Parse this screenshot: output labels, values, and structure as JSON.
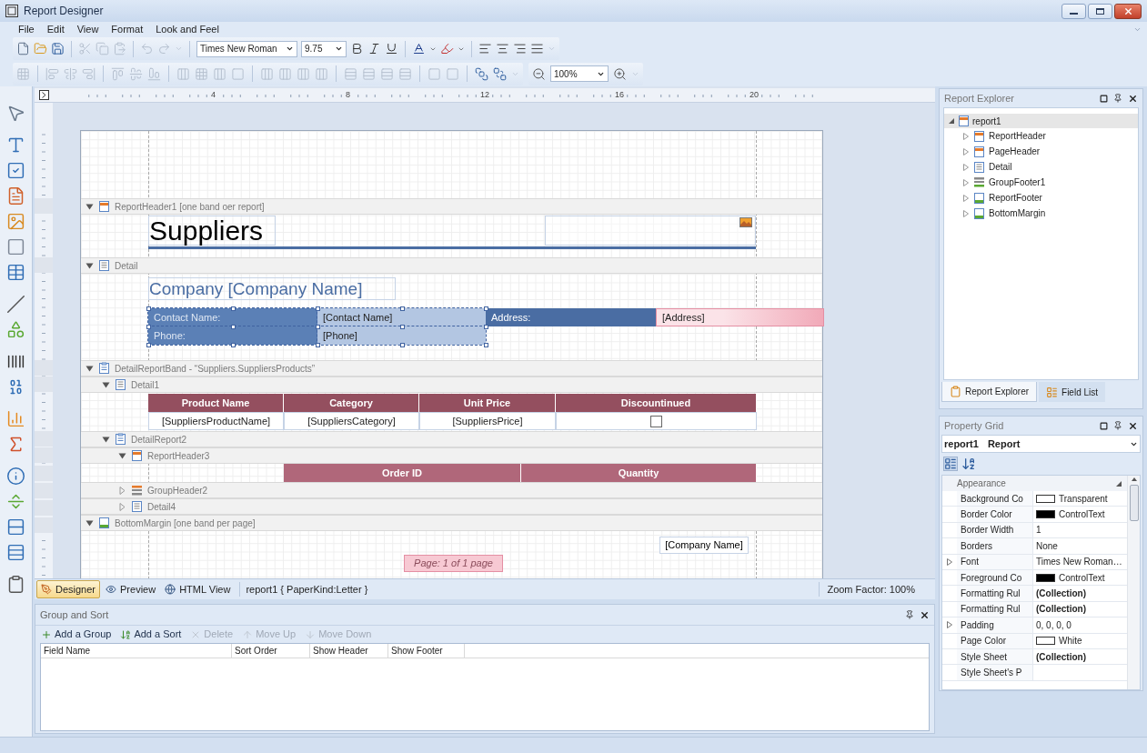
{
  "window": {
    "title": "Report Designer"
  },
  "menu": [
    "File",
    "Edit",
    "View",
    "Format",
    "Look and Feel"
  ],
  "toolbar": {
    "font": "Times New Roman",
    "size": "9.75",
    "zoom": "100%"
  },
  "ruler": [
    "4",
    "8",
    "12",
    "16",
    "20"
  ],
  "bands": [
    {
      "label": "ReportHeader1 [one band oer report]",
      "kind": "report_header",
      "expanded": true,
      "content": {
        "kind": "title",
        "title": "Suppliers"
      }
    },
    {
      "label": "Detail",
      "kind": "detail",
      "expanded": true,
      "content": {
        "kind": "company",
        "heading": "Company [Company Name]",
        "rows": [
          [
            {
              "text": "Contact Name:",
              "selected": true
            },
            {
              "text": "[Contact Name]",
              "selected": true
            },
            {
              "text": "Address:",
              "selected": false
            },
            {
              "text": "[Address]",
              "selected": false
            }
          ],
          [
            {
              "text": "Phone:",
              "selected": true
            },
            {
              "text": "[Phone]",
              "selected": true
            }
          ]
        ]
      }
    },
    {
      "label": "DetailReportBand - “Suppliers.SuppliersProducts”",
      "kind": "detail_report",
      "expanded": true,
      "children": [
        {
          "label": "Detail1",
          "kind": "detail",
          "expanded": true,
          "content": {
            "kind": "table",
            "headers": [
              "Product Name",
              "Category",
              "Unit Price",
              "Discountinued"
            ],
            "cells": [
              {
                "kind": "text",
                "text": "[SuppliersProductName]"
              },
              {
                "kind": "text",
                "text": "[SuppliersCategory]"
              },
              {
                "kind": "text",
                "text": "[SuppliersPrice]"
              },
              {
                "kind": "checkbox",
                "checked": false
              }
            ]
          }
        },
        {
          "label": "DetailReport2",
          "kind": "detail_report",
          "expanded": true,
          "children": [
            {
              "label": "ReportHeader3",
              "kind": "report_header",
              "expanded": true,
              "content": {
                "kind": "header_row",
                "headers": [
                  "Order ID",
                  "Quantity"
                ]
              }
            },
            {
              "label": "GroupHeader2",
              "kind": "group_header",
              "expanded": false
            },
            {
              "label": "Detail4",
              "kind": "detail",
              "expanded": false
            }
          ]
        }
      ]
    },
    {
      "label": "BottomMargin [one band per page]",
      "kind": "bottom_margin",
      "expanded": true,
      "content": {
        "kind": "margin",
        "field": "[Company Name]",
        "page_info": "Page: 1 of 1 page"
      }
    }
  ],
  "designer_tabs": [
    {
      "label": "Designer",
      "selected": true
    },
    {
      "label": "Preview",
      "selected": false
    },
    {
      "label": "HTML View",
      "selected": false
    }
  ],
  "designer_status": {
    "report": "report1 { PaperKind:Letter }",
    "zoom": "Zoom Factor: 100%"
  },
  "group_and_sort": {
    "title": "Group and Sort",
    "actions": [
      {
        "label": "Add a Group",
        "disabled": false
      },
      {
        "label": "Add a Sort",
        "disabled": false
      },
      {
        "label": "Delete",
        "disabled": true
      },
      {
        "label": "Move Up",
        "disabled": true
      },
      {
        "label": "Move Down",
        "disabled": true
      }
    ],
    "columns": [
      "Field Name",
      "Sort Order",
      "Show Header",
      "Show Footer"
    ]
  },
  "report_explorer": {
    "title": "Report Explorer",
    "tree": {
      "label": "report1",
      "selected": true,
      "expanded": true,
      "children": [
        {
          "label": "ReportHeader",
          "kind": "report_header",
          "selected": false,
          "expanded": false
        },
        {
          "label": "PageHeader",
          "kind": "page_header",
          "selected": false,
          "expanded": false
        },
        {
          "label": "Detail",
          "kind": "detail",
          "selected": false,
          "expanded": false
        },
        {
          "label": "GroupFooter1",
          "kind": "group_footer",
          "selected": false,
          "expanded": false
        },
        {
          "label": "ReportFooter",
          "kind": "report_footer",
          "selected": false,
          "expanded": false
        },
        {
          "label": "BottomMargin",
          "kind": "bottom_margin",
          "selected": false,
          "expanded": false
        }
      ]
    }
  },
  "explorer_tabs": [
    {
      "label": "Report Explorer",
      "selected": true
    },
    {
      "label": "Field List",
      "selected": false
    }
  ],
  "property_grid": {
    "title": "Property Grid",
    "object": "report1",
    "type": "Report",
    "category": "Appearance",
    "rows": [
      {
        "label": "Background Co",
        "value": "Transparent",
        "kind": "color",
        "color": "#ffffff",
        "expandable": false
      },
      {
        "label": "Border Color",
        "value": "ControlText",
        "kind": "color",
        "color": "#000000",
        "expandable": false
      },
      {
        "label": "Border Width",
        "value": "1",
        "kind": "text",
        "expandable": false
      },
      {
        "label": "Borders",
        "value": "None",
        "kind": "text",
        "expandable": false
      },
      {
        "label": "Font",
        "value": "Times New Roman…",
        "kind": "text",
        "expandable": true
      },
      {
        "label": "Foreground Co",
        "value": "ControlText",
        "kind": "color",
        "color": "#000000",
        "expandable": false
      },
      {
        "label": "Formatting Rul",
        "value": "(Collection)",
        "kind": "collection",
        "expandable": false
      },
      {
        "label": "Formatting Rul",
        "value": "(Collection)",
        "kind": "collection",
        "expandable": false
      },
      {
        "label": "Padding",
        "value": "0, 0, 0, 0",
        "kind": "text",
        "expandable": true
      },
      {
        "label": "Page Color",
        "value": "White",
        "kind": "color",
        "color": "#ffffff",
        "expandable": false
      },
      {
        "label": "Style Sheet",
        "value": "(Collection)",
        "kind": "collection",
        "expandable": false
      },
      {
        "label": "Style Sheet's P",
        "value": "",
        "kind": "text",
        "expandable": false
      }
    ]
  }
}
